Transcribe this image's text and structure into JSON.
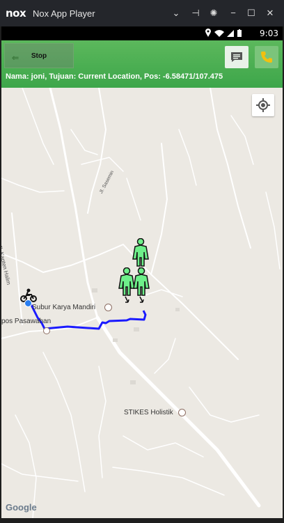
{
  "window": {
    "logo": "nox",
    "title": "Nox App Player",
    "controls": [
      "chevron-down-icon",
      "pin-icon",
      "gear-icon",
      "minimize-icon",
      "maximize-icon",
      "close-icon"
    ]
  },
  "statusbar": {
    "time": "9:03",
    "icons": [
      "location-icon",
      "wifi-icon",
      "signal-icon",
      "battery-icon"
    ]
  },
  "appbar": {
    "stop_label": "Stop",
    "info": "Nama: joni, Tujuan: Current Location, Pos: -6.58471/107.475",
    "color": "#4caf50"
  },
  "map": {
    "labels": {
      "place1": "Subur Karya Mandiri",
      "place2": "pos Pasawahan",
      "place3": "STIKES Holistik",
      "road1": "Jl. Kapten Halim",
      "road2": "Jl. Sasemin"
    },
    "attribution": "Google",
    "route_color": "#1a1aff"
  }
}
